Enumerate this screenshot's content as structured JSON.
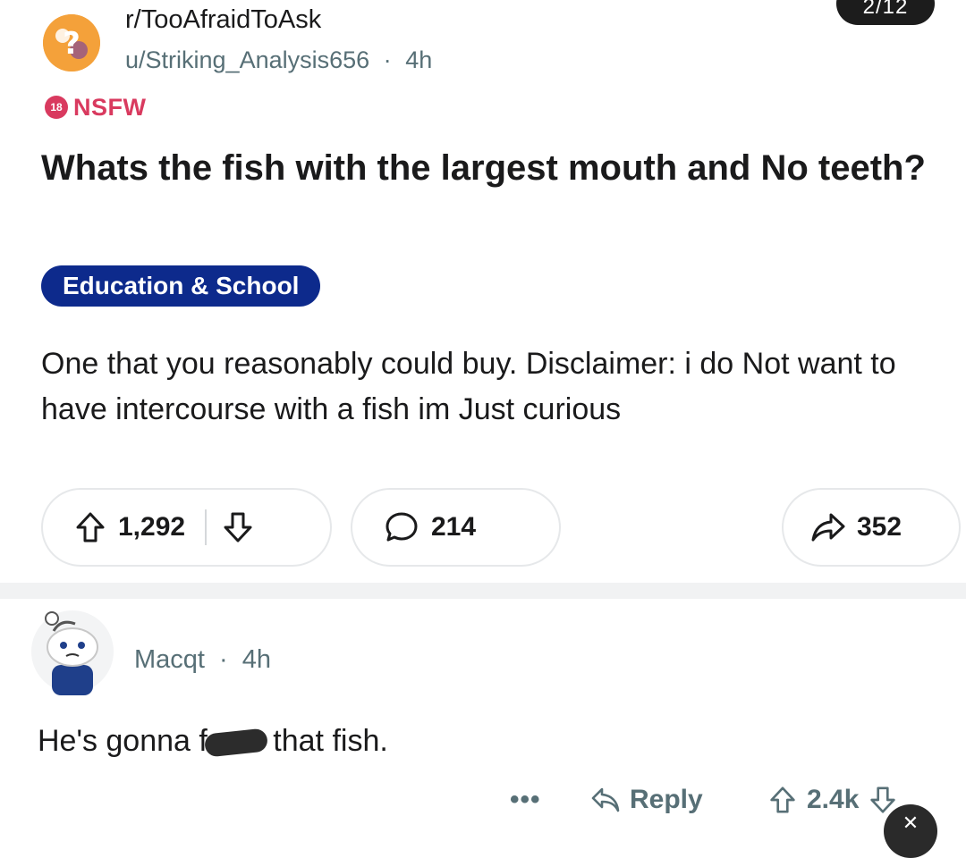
{
  "overlay": {
    "page_counter": "2/12"
  },
  "post": {
    "subreddit": "r/TooAfraidToAsk",
    "author": "u/Striking_Analysis656",
    "separator": "·",
    "age": "4h",
    "nsfw_badge": "18",
    "nsfw_label": "NSFW",
    "title": "Whats the fish with the largest mouth and No teeth?",
    "flair": "Education & School",
    "body": "One that you reasonably could buy. Disclaimer: i do Not want to have intercourse with a fish im Just curious",
    "upvotes": "1,292",
    "comments": "214",
    "shares": "352"
  },
  "comment": {
    "username": "Macqt",
    "separator": "·",
    "age": "4h",
    "text_before": "He's gonna f",
    "text_after": " that fish.",
    "more_label": "•••",
    "reply_label": "Reply",
    "votes": "2.4k"
  },
  "colors": {
    "nsfw": "#d93a5f",
    "flair_bg": "#0d2a8c",
    "meta_text": "#576f76",
    "subreddit_icon": "#f4a13a"
  },
  "icons": {
    "upvote": "upvote-arrow-icon",
    "downvote": "downvote-arrow-icon",
    "comment": "speech-bubble-icon",
    "share": "share-arrow-icon",
    "reply": "reply-arrow-icon",
    "close": "close-icon"
  }
}
